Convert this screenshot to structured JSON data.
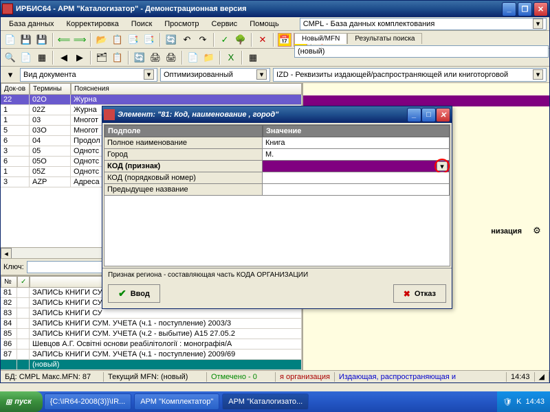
{
  "window": {
    "title": "ИРБИС64 - АРМ \"Каталогизатор\" - Демонстрационная версия"
  },
  "menu": {
    "database": "База данных",
    "correct": "Корректировка",
    "search": "Поиск",
    "view": "Просмотр",
    "service": "Сервис",
    "help": "Помощь"
  },
  "db_selector": "CMPL - База данных комплектования",
  "right_tabs": {
    "tab1": "Новый/MFN",
    "tab2": "Результаты поиска",
    "mfn_value": "(новый)"
  },
  "filters": {
    "doc_type": "Вид документа",
    "optimized": "Оптимизированный",
    "izd": "IZD - Реквизиты издающей/распространяющей или книготорговой"
  },
  "grid": {
    "headers": {
      "c1": "Док-ов",
      "c2": "Термины",
      "c3": "Пояснения",
      "c4": "№",
      "c5": ""
    },
    "rows": [
      {
        "c1": "22",
        "c2": "02O",
        "c3": "Журна"
      },
      {
        "c1": "1",
        "c2": "02Z",
        "c3": "Журна"
      },
      {
        "c1": "1",
        "c2": "03",
        "c3": "Многот"
      },
      {
        "c1": "5",
        "c2": "03O",
        "c3": "Многот"
      },
      {
        "c1": "6",
        "c2": "04",
        "c3": "Продол"
      },
      {
        "c1": "3",
        "c2": "05",
        "c3": "Однотс"
      },
      {
        "c1": "6",
        "c2": "05O",
        "c3": "Однотс"
      },
      {
        "c1": "1",
        "c2": "05Z",
        "c3": "Однотс"
      },
      {
        "c1": "3",
        "c2": "AZP",
        "c3": "Адреса"
      }
    ]
  },
  "key_label": "Ключ:",
  "bottom": {
    "headers": {
      "c1": "№",
      "c2": "✓",
      "c3": ""
    },
    "rows": [
      {
        "n": "81",
        "t": "ЗАПИСЬ КНИГИ СУ"
      },
      {
        "n": "82",
        "t": "ЗАПИСЬ КНИГИ СУ"
      },
      {
        "n": "83",
        "t": "ЗАПИСЬ КНИГИ СУ"
      },
      {
        "n": "84",
        "t": "ЗАПИСЬ КНИГИ СУМ. УЧЕТА (ч.1 - поступление)  2003/3"
      },
      {
        "n": "85",
        "t": "ЗАПИСЬ КНИГИ СУМ. УЧЕТА (ч.2 - выбытие)  А15 27.05.2"
      },
      {
        "n": "86",
        "t": "Шевцов А.Г. Освітні основи реабілітології : монографія/А"
      },
      {
        "n": "87",
        "t": "ЗАПИСЬ КНИГИ СУМ. УЧЕТА (ч.1 - поступление)  2009/69"
      }
    ],
    "new_label": "(новый)"
  },
  "status": {
    "s1": "БД: CMPL Макс.MFN: 87",
    "s2": "Текущий MFN: (новый)",
    "s3": "Отмечено - 0",
    "s4": "я организация",
    "s5": "Издающая, распространяющая и",
    "s6": "14:43"
  },
  "right_label": "низация",
  "dialog": {
    "title": "Элемент: \"81: Код, наименование , город\"",
    "col1": "Подполе",
    "col2": "Значение",
    "rows": [
      {
        "label": "Полное наименование",
        "value": "Книга"
      },
      {
        "label": "Город",
        "value": "М."
      },
      {
        "label": "КОД (признак)",
        "value": "",
        "selected": true
      },
      {
        "label": "КОД (порядковый номер)",
        "value": ""
      },
      {
        "label": "Предыдущее название",
        "value": ""
      }
    ],
    "hint": "Признак региона - составляющая  часть  КОДА ОРГАНИЗАЦИИ",
    "ok": "Ввод",
    "cancel": "Отказ"
  },
  "taskbar": {
    "start": "пуск",
    "items": [
      "{C:\\IR64-2008(3)}\\IR...",
      "АРМ \"Комплектатор\"",
      "АРМ \"Каталогизато..."
    ],
    "clock": "14:43"
  }
}
